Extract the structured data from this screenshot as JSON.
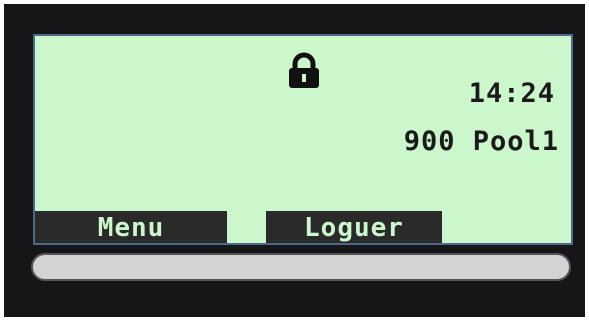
{
  "display": {
    "lock_icon": "lock-icon",
    "time": "14:24",
    "status_line": "900 Pool1",
    "softkeys": {
      "left": "Menu",
      "right": "Loguer"
    }
  },
  "colors": {
    "lcd_background": "#ccf7cc",
    "device_frame": "#161618",
    "softkey_background": "#2a2a2a"
  }
}
